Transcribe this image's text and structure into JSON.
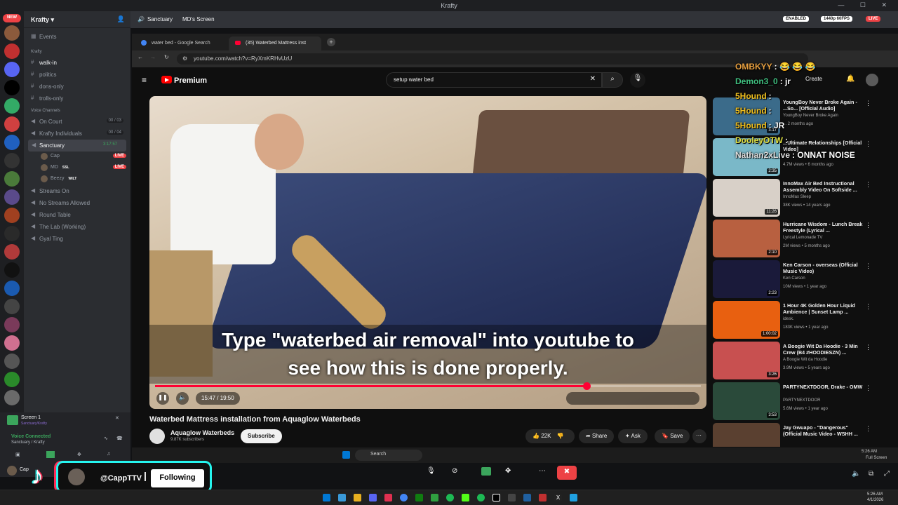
{
  "window": {
    "title": "Krafty"
  },
  "server": {
    "name": "Krafty",
    "events": "Events",
    "category": "Krafty"
  },
  "text_channels": [
    "walk-in",
    "politics",
    "dons-only",
    "trolls-only"
  ],
  "voice_category": "Voice Channels",
  "voice_channels": [
    {
      "name": "On Court",
      "count": "00 / 03"
    },
    {
      "name": "Krafty Individuals",
      "count": "00 / 04"
    },
    {
      "name": "Sanctuary",
      "count": "3:17:57",
      "active": true
    }
  ],
  "sanctuary_members": [
    {
      "name": "Cap",
      "badge": "LIVE"
    },
    {
      "name": "MD",
      "tag": "SSL",
      "badge": "LIVE"
    },
    {
      "name": "Beezy",
      "tag": "WILT"
    }
  ],
  "more_voice_channels": [
    "Streams On",
    "No Streams Allowed",
    "Round Table",
    "The Lab (Working)",
    "Gyal Ting"
  ],
  "discord_topbar": {
    "channel": "Sanctuary",
    "screen": "MD's Screen",
    "enabled": "ENABLED",
    "quality": "1440p 60FPS",
    "live": "LIVE"
  },
  "voice_panel": {
    "screen": "Screen 1",
    "screen_sub": "Sanctuary/Krafty",
    "status": "Voice Connected",
    "location": "Sanctuary / Krafty",
    "user": "Cap"
  },
  "browser": {
    "tabs": [
      {
        "label": "water bed - Google Search"
      },
      {
        "label": "(35) Waterbed Mattress inst"
      }
    ],
    "url": "youtube.com/watch?v=RyXmKRHvUzU"
  },
  "youtube": {
    "logo": "Premium",
    "search_value": "setup water bed",
    "create": "Create",
    "caption_line1": "Type \"waterbed air removal\" into youtube to",
    "caption_line2": "see how this is done properly.",
    "time": "15:47 / 19:50",
    "progress": 0.79,
    "video_title": "Waterbed Mattress installation from Aquaglow Waterbeds",
    "channel": "Aquaglow Waterbeds",
    "subscribers": "9.87K subscribers",
    "subscribe": "Subscribe",
    "likes": "22K",
    "share": "Share",
    "ask": "Ask",
    "save": "Save"
  },
  "recommendations": [
    {
      "title": "YoungBoy Never Broke Again - ...So... [Official Audio]",
      "channel": "YoungBoy Never Broke Again",
      "meta": "... 2 months ago",
      "duration": "3:17",
      "color": "#3b6b8a"
    },
    {
      "title": "...Ultimate Relationships [Official Video]",
      "channel": "...",
      "meta": "4.7M views • 6 months ago",
      "duration": "2:35",
      "color": "#7ab8c8"
    },
    {
      "title": "InnoMax Air Bed Instructional Assembly Video On Softside ...",
      "channel": "InnoMax Sleep",
      "meta": "38K views • 14 years ago",
      "duration": "11:26",
      "color": "#d8d0c8"
    },
    {
      "title": "Hurricane Wisdom - Lunch Break Freestyle (Lyrical ...",
      "channel": "Lyrical Lemonade TV",
      "meta": "2M views • 5 months ago",
      "duration": "2:10",
      "color": "#b86040"
    },
    {
      "title": "Ken Carson - overseas (Official Music Video)",
      "channel": "Ken Carson",
      "meta": "10M views • 1 year ago",
      "duration": "2:23",
      "color": "#1a1a3a"
    },
    {
      "title": "1 Hour 4K Golden Hour Liquid Ambience | Sunset Lamp ...",
      "channel": "idesk.",
      "meta": "183K views • 1 year ago",
      "duration": "1:00:02",
      "color": "#e86010"
    },
    {
      "title": "A Boogie Wit Da Hoodie - 3 Min Crew (B4 #HOODIESZN) ...",
      "channel": "A Boogie Wit da Hoodie",
      "meta": "3.9M views • 5 years ago",
      "duration": "3:26",
      "color": "#c85050"
    },
    {
      "title": "PARTYNEXTDOOR, Drake - OMW",
      "channel": "PARTYNEXTDOOR",
      "meta": "5.6M views • 1 year ago",
      "duration": "3:53",
      "color": "#2a4a3a"
    },
    {
      "title": "Jay Gwuapo - \"Dangerous\" (Official Music Video - WSHH ...",
      "channel": "",
      "meta": "",
      "duration": "",
      "color": "#5a4030"
    }
  ],
  "chat": [
    {
      "user": "OMBKYY",
      "msg": ": 😂 😂 😂",
      "color": "#e8a040"
    },
    {
      "user": "Demon3_0",
      "msg": ": jr",
      "color": "#40c080"
    },
    {
      "user": "5Hound",
      "msg": ":",
      "color": "#f0c020"
    },
    {
      "user": "5Hound",
      "msg": ":",
      "color": "#f0c020"
    },
    {
      "user": "5Hound",
      "msg": ": JR",
      "color": "#f0c020"
    },
    {
      "user": "DooleyOTW",
      "msg": ":",
      "color": "#e0e040"
    },
    {
      "user": "Nathan2xLive",
      "msg": ": ONNAT NOISE",
      "color": "#e0e0e0"
    }
  ],
  "tiktok": {
    "handle": "@CappTTV",
    "button": "Following"
  },
  "taskbar": {
    "search": "Search",
    "time": "5:26 AM",
    "date": "4/1/2026",
    "fullscreen": "Full Screen"
  }
}
